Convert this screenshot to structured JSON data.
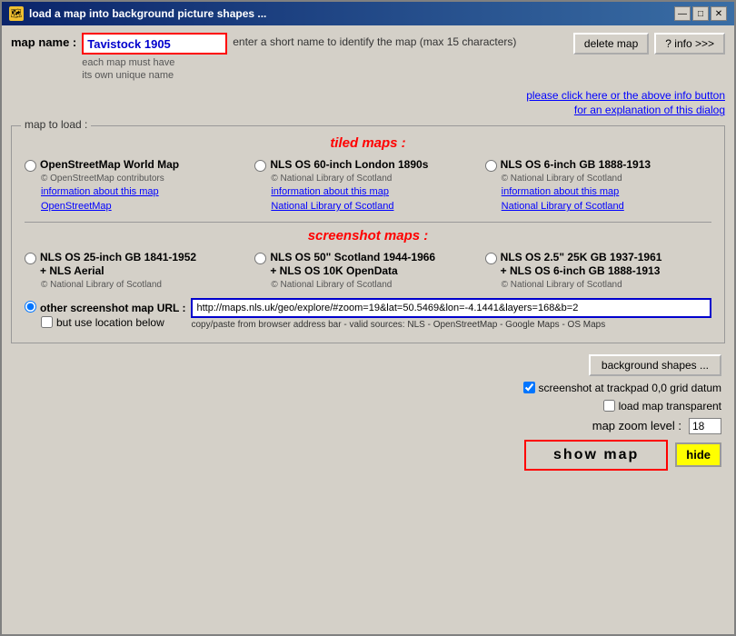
{
  "window": {
    "title": "load  a  map  into  background  picture  shapes  ...",
    "icon": "🗺"
  },
  "title_buttons": {
    "minimize": "—",
    "maximize": "□",
    "close": "✕"
  },
  "header": {
    "map_name_label": "map name :",
    "map_name_value": "Tavistock 1905",
    "map_name_desc": "enter a short name to identify the map (max 15 characters)",
    "map_name_hint_line1": "each map must have",
    "map_name_hint_line2": "its own unique name",
    "delete_map_label": "delete map",
    "info_label": "? info >>>",
    "info_link_line1": "please click here or the above info button",
    "info_link_line2": "for an explanation of this dialog"
  },
  "map_to_load": {
    "legend": "map to load :",
    "tiled_label": "tiled maps :",
    "screenshot_label": "screenshot maps :",
    "tiled_maps": [
      {
        "id": "osm",
        "name": "OpenStreetMap World Map",
        "copy": "© OpenStreetMap contributors",
        "link1": "information about this map",
        "link2": "OpenStreetMap",
        "checked": false
      },
      {
        "id": "nls60",
        "name": "NLS OS 60-inch  London 1890s",
        "copy": "© National Library of Scotland",
        "link1": "information about this map",
        "link2": "National Library of Scotland",
        "checked": false
      },
      {
        "id": "nls6",
        "name": "NLS OS 6-inch GB 1888-1913",
        "copy": "© National Library of Scotland",
        "link1": "information about this map",
        "link2": "National Library of Scotland",
        "checked": false
      }
    ],
    "screenshot_maps": [
      {
        "id": "nls25",
        "name": "NLS OS 25-inch GB 1841-1952",
        "name2": "+ NLS Aerial",
        "copy": "© National Library of Scotland",
        "link1": "",
        "link2": "",
        "checked": false
      },
      {
        "id": "nls50",
        "name": "NLS OS 50\"  Scotland 1944-1966",
        "name2": "+ NLS OS 10K OpenData",
        "copy": "© National Library of Scotland",
        "link1": "",
        "link2": "",
        "checked": false
      },
      {
        "id": "nls25k",
        "name": "NLS OS 2.5\" 25K GB 1937-1961",
        "name2": "+ NLS OS 6-inch GB 1888-1913",
        "copy": "© National Library of Scotland",
        "link1": "",
        "link2": "",
        "checked": false
      }
    ],
    "other_url_label": "other  screenshot  map  URL :",
    "other_url_value": "http://maps.nls.uk/geo/explore/#zoom=19&lat=50.5469&lon=-4.1441&layers=168&b=2",
    "other_url_hint": "copy/paste from browser address bar - valid sources: NLS - OpenStreetMap - Google Maps - OS Maps",
    "other_checked": true,
    "but_use_label": "but use location below"
  },
  "bottom": {
    "bg_shapes_label": "background  shapes  ...",
    "screenshot_checkbox_label": "screenshot at trackpad 0,0 grid datum",
    "screenshot_checked": true,
    "transparent_label": "load map transparent",
    "transparent_checked": false,
    "zoom_label": "map zoom level :",
    "zoom_value": "18",
    "show_map_label": "show  map",
    "hide_label": "hide"
  }
}
